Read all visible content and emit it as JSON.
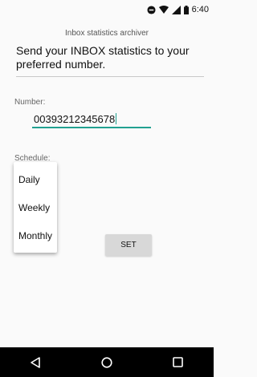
{
  "status_bar": {
    "time": "6:40",
    "icons": [
      "do-not-disturb-icon",
      "wifi-icon",
      "signal-icon",
      "battery-icon"
    ]
  },
  "app": {
    "title": "Inbox statistics archiver"
  },
  "message": {
    "value": "Send your INBOX statistics to your preferred number."
  },
  "number": {
    "label": "Number:",
    "value": "00393212345678"
  },
  "schedule": {
    "label": "Schedule:",
    "options": [
      "Daily",
      "Weekly",
      "Monthly"
    ]
  },
  "set_button": {
    "label": "SET"
  },
  "nav_bar": {
    "icons": [
      "back-icon",
      "home-icon",
      "recents-icon"
    ]
  },
  "colors": {
    "accent": "#21a191",
    "nav_background": "#000000"
  }
}
